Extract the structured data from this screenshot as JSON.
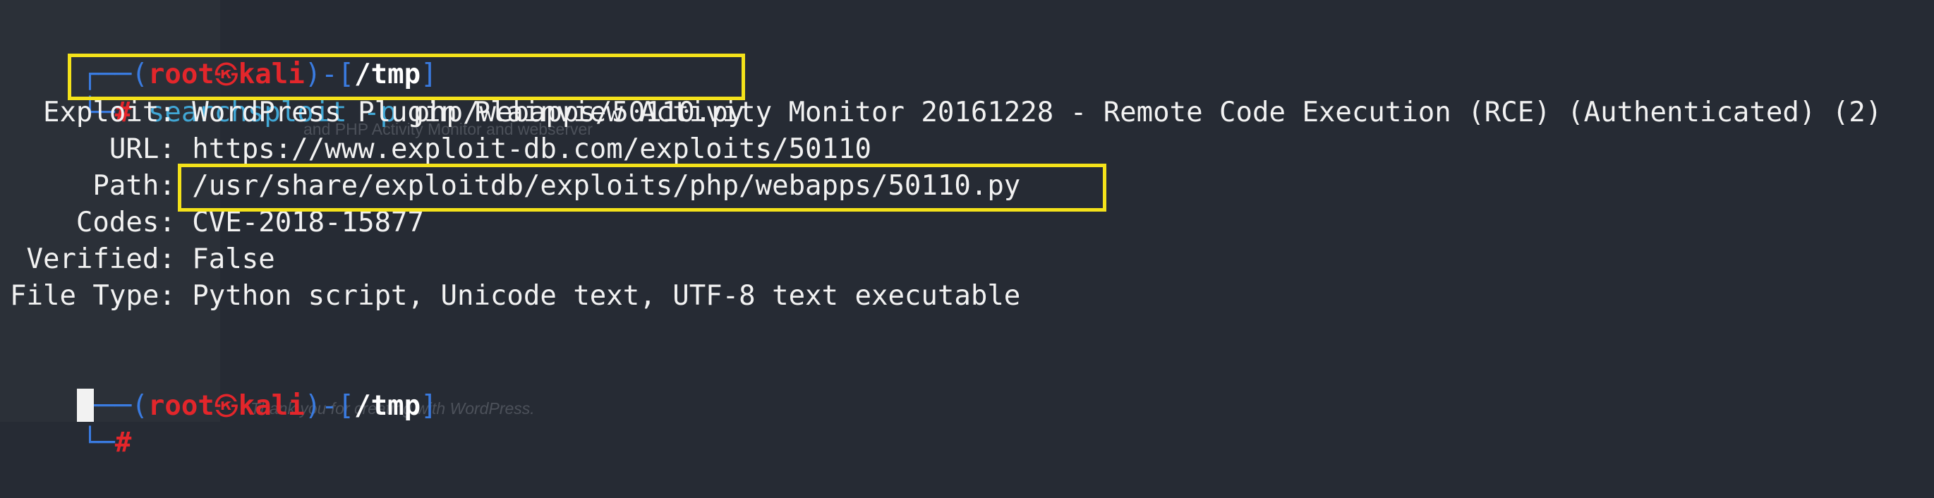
{
  "colors": {
    "background": "#262b34",
    "left_panel": "#2b3038",
    "prompt_frame": "#3a7be0",
    "user_host": "#e3262b",
    "path": "#ffffff",
    "command": "#41a7d5",
    "output_text": "#f2f2f2",
    "highlight_box": "#f4e21a"
  },
  "prompt": {
    "top_corner": "┌──",
    "open_paren": "(",
    "user": "root",
    "skull_icon": "㉿",
    "host": "kali",
    "close_paren_dash": ")-[",
    "cwd": "/tmp",
    "close_bracket": "]",
    "bottom_corner": "└─",
    "symbol": "#"
  },
  "command": {
    "program": "searchsploit",
    "flag": "-p",
    "argument": "php/webapps/50110.py"
  },
  "output": [
    {
      "key": "  Exploit:",
      "value": " WordPress Plugin Plainview Activity Monitor 20161228 - Remote Code Execution (RCE) (Authenticated) (2)"
    },
    {
      "key": "      URL:",
      "value": " https://www.exploit-db.com/exploits/50110"
    },
    {
      "key": "     Path:",
      "value": " /usr/share/exploitdb/exploits/php/webapps/50110.py"
    },
    {
      "key": "    Codes:",
      "value": " CVE-2018-15877"
    },
    {
      "key": " Verified:",
      "value": " False"
    },
    {
      "key": "File Type:",
      "value": " Python script, Unicode text, UTF-8 text executable"
    }
  ],
  "background_ghost_text": {
    "line1": "and PHP Activity Monitor and webserver",
    "line2": "Thank you for creating with WordPress."
  }
}
